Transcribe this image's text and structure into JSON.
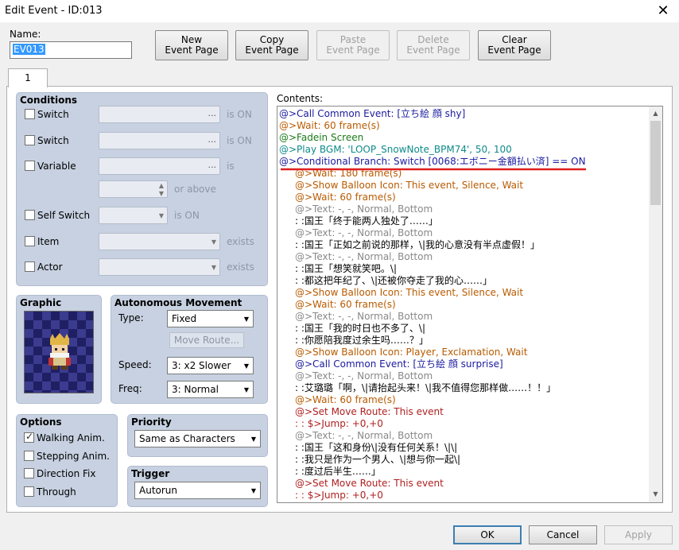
{
  "window": {
    "title": "Edit Event - ID:013"
  },
  "name": {
    "label": "Name:",
    "value": "EV013"
  },
  "toolbar": {
    "new_page": "New\nEvent Page",
    "copy_page": "Copy\nEvent Page",
    "paste_page": "Paste\nEvent Page",
    "delete_page": "Delete\nEvent Page",
    "clear_page": "Clear\nEvent Page"
  },
  "tabs": [
    "1"
  ],
  "conditions": {
    "title": "Conditions",
    "switch1": "Switch",
    "switch2": "Switch",
    "variable": "Variable",
    "self_switch": "Self Switch",
    "item": "Item",
    "actor": "Actor",
    "dots": "...",
    "is_on": "is ON",
    "is": "is",
    "or_above": "or above",
    "exists": "exists"
  },
  "graphic": {
    "title": "Graphic"
  },
  "autonomous": {
    "title": "Autonomous Movement",
    "type_label": "Type:",
    "type_value": "Fixed",
    "move_route": "Move Route...",
    "speed_label": "Speed:",
    "speed_value": "3: x2 Slower",
    "freq_label": "Freq:",
    "freq_value": "3: Normal"
  },
  "options": {
    "title": "Options",
    "walking": "Walking Anim.",
    "stepping": "Stepping Anim.",
    "direction_fix": "Direction Fix",
    "through": "Through"
  },
  "priority": {
    "title": "Priority",
    "value": "Same as Characters"
  },
  "trigger": {
    "title": "Trigger",
    "value": "Autorun"
  },
  "contents": {
    "label": "Contents:",
    "lines": [
      {
        "text": "@>Call Common Event: [立ち絵 顔 shy]",
        "color": "#1a1aa0",
        "indent": 0
      },
      {
        "text": "@>Wait: 60 frame(s)",
        "color": "#b85a00",
        "indent": 0
      },
      {
        "text": "@>Fadein Screen",
        "color": "#1a7a1a",
        "indent": 0
      },
      {
        "text": "@>Play BGM: 'LOOP_SnowNote_BPM74', 50, 100",
        "color": "#0f8a8a",
        "indent": 0
      },
      {
        "text": "@>Conditional Branch: Switch [0068:エボニー金額払い済] == ON",
        "color": "#1a1aa0",
        "indent": 0
      },
      {
        "text": "@>Wait: 180 frame(s)",
        "color": "#b85a00",
        "indent": 1
      },
      {
        "text": "@>Show Balloon Icon: This event, Silence, Wait",
        "color": "#b85a00",
        "indent": 1
      },
      {
        "text": "@>Wait: 60 frame(s)",
        "color": "#b85a00",
        "indent": 1
      },
      {
        "text": "@>Text: -, -, Normal, Bottom",
        "color": "#888888",
        "indent": 1
      },
      {
        "text": ":       :国王「终于能两人独处了……」",
        "color": "#000000",
        "indent": 1
      },
      {
        "text": "@>Text: -, -, Normal, Bottom",
        "color": "#888888",
        "indent": 1
      },
      {
        "text": ":       :国王「正如之前说的那样，\\|我的心意没有半点虚假！」",
        "color": "#000000",
        "indent": 1
      },
      {
        "text": "@>Text: -, -, Normal, Bottom",
        "color": "#888888",
        "indent": 1
      },
      {
        "text": ":       :国王「想笑就笑吧。\\|",
        "color": "#000000",
        "indent": 1
      },
      {
        "text": ":       :都这把年纪了、\\|还被你夺走了我的心……」",
        "color": "#000000",
        "indent": 1
      },
      {
        "text": "@>Show Balloon Icon: This event, Silence, Wait",
        "color": "#b85a00",
        "indent": 1
      },
      {
        "text": "@>Wait: 60 frame(s)",
        "color": "#b85a00",
        "indent": 1
      },
      {
        "text": "@>Text: -, -, Normal, Bottom",
        "color": "#888888",
        "indent": 1
      },
      {
        "text": ":       :国王「我的时日也不多了、\\|",
        "color": "#000000",
        "indent": 1
      },
      {
        "text": ":       :你愿陪我度过余生吗……？」",
        "color": "#000000",
        "indent": 1
      },
      {
        "text": "@>Show Balloon Icon: Player, Exclamation, Wait",
        "color": "#b85a00",
        "indent": 1
      },
      {
        "text": "@>Call Common Event: [立ち絵 顔 surprise]",
        "color": "#1a1aa0",
        "indent": 1
      },
      {
        "text": "@>Text: -, -, Normal, Bottom",
        "color": "#888888",
        "indent": 1
      },
      {
        "text": ":       :艾璐璐「啊，\\|请抬起头来！\\|我不值得您那样做……！！」",
        "color": "#000000",
        "indent": 1
      },
      {
        "text": "@>Wait: 60 frame(s)",
        "color": "#b85a00",
        "indent": 1
      },
      {
        "text": "@>Set Move Route: This event",
        "color": "#b02020",
        "indent": 1
      },
      {
        "text": ":               : $>Jump: +0,+0",
        "color": "#b02020",
        "indent": 1
      },
      {
        "text": "@>Text: -, -, Normal, Bottom",
        "color": "#888888",
        "indent": 1
      },
      {
        "text": ":       :国王「这和身份\\|没有任何关系！\\|\\|",
        "color": "#000000",
        "indent": 1
      },
      {
        "text": ":       :我只是作为一个男人、\\|想与你一起\\|",
        "color": "#000000",
        "indent": 1
      },
      {
        "text": ":       :度过后半生……」",
        "color": "#000000",
        "indent": 1
      },
      {
        "text": "@>Set Move Route: This event",
        "color": "#b02020",
        "indent": 1
      },
      {
        "text": ":               : $>Jump: +0,+0",
        "color": "#b02020",
        "indent": 1
      }
    ]
  },
  "bottom": {
    "ok": "OK",
    "cancel": "Cancel",
    "apply": "Apply"
  },
  "colors": {
    "panel": "#c7d1e1",
    "highlight": "#3399ff",
    "annotation": "#e02020"
  }
}
